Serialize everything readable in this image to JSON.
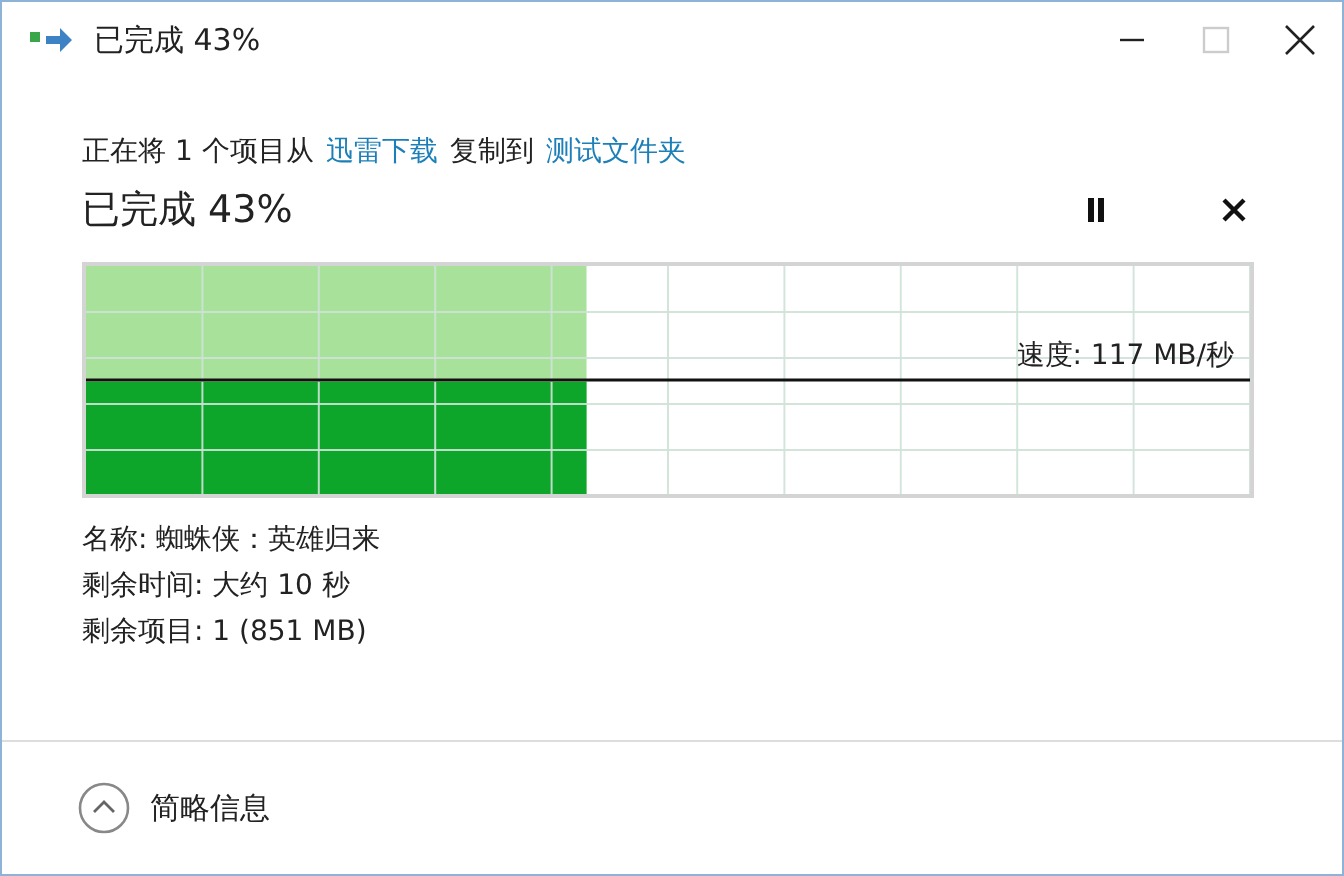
{
  "window": {
    "title": "已完成 43%",
    "buttons": [
      {
        "kind": "minimize",
        "disabled": false
      },
      {
        "kind": "maximize",
        "disabled": true
      },
      {
        "kind": "close",
        "disabled": false
      }
    ]
  },
  "copy_line": {
    "prefix": "正在将 1 个项目从",
    "source": "迅雷下载",
    "middle": "复制到",
    "destination": "测试文件夹"
  },
  "progress": {
    "heading": "已完成 43%",
    "level": 0.43,
    "speed": "速度: 117 MB/秒"
  },
  "details": [
    "名称: 蜘蛛侠：英雄归来",
    "剩余时间: 大约 10 秒",
    "剩余项目: 1 (851 MB)"
  ],
  "footer": {
    "label": "简略信息",
    "expanded": true
  }
}
